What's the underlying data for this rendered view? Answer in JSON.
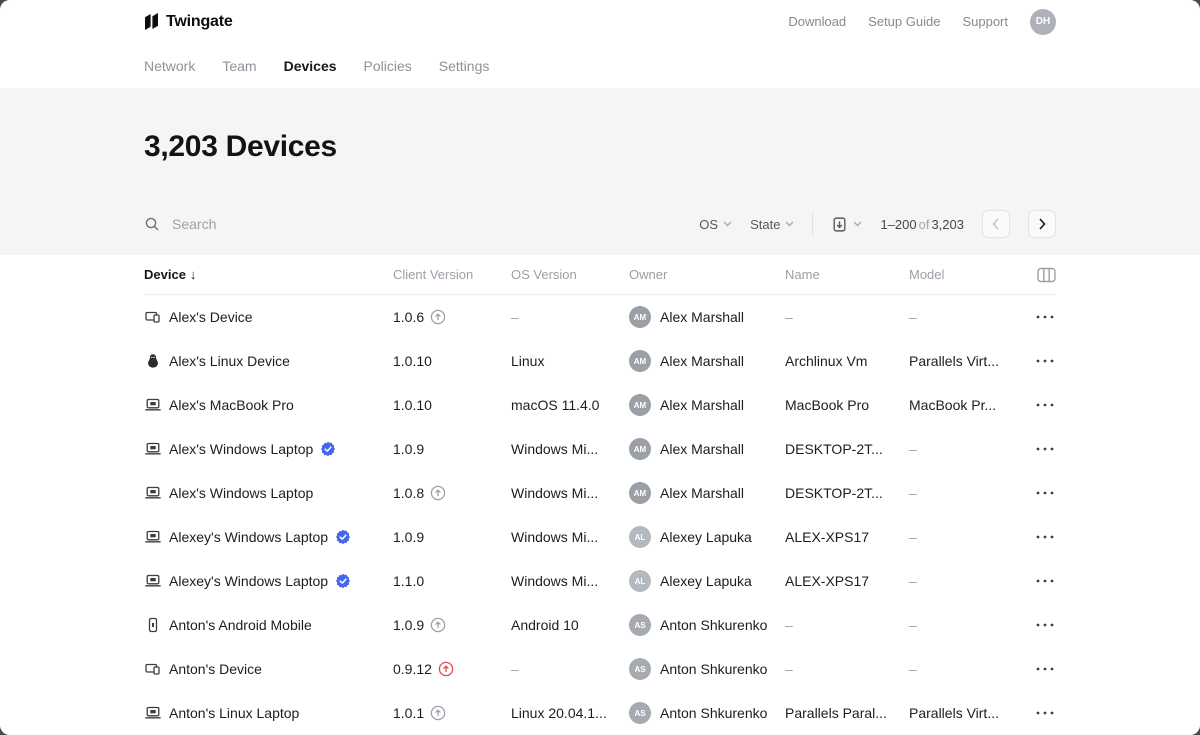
{
  "header": {
    "logo_text": "Twingate",
    "links": [
      {
        "label": "Download"
      },
      {
        "label": "Setup Guide"
      },
      {
        "label": "Support"
      }
    ],
    "avatar_initials": "DH"
  },
  "nav": {
    "items": [
      {
        "label": "Network",
        "active": false
      },
      {
        "label": "Team",
        "active": false
      },
      {
        "label": "Devices",
        "active": true
      },
      {
        "label": "Policies",
        "active": false
      },
      {
        "label": "Settings",
        "active": false
      }
    ]
  },
  "page": {
    "title": "3,203 Devices"
  },
  "toolbar": {
    "search_placeholder": "Search",
    "filters": [
      {
        "label": "OS"
      },
      {
        "label": "State"
      }
    ],
    "pagination": {
      "range": "1–200",
      "of_label": "of",
      "total": "3,203"
    }
  },
  "table": {
    "columns": {
      "device": "Device",
      "client_version": "Client Version",
      "os_version": "OS Version",
      "owner": "Owner",
      "name": "Name",
      "model": "Model"
    },
    "sort_arrow": "↓",
    "rows": [
      {
        "icon": "device-combo",
        "device": "Alex's Device",
        "verified": false,
        "client_version": "1.0.6",
        "update": "gray",
        "os_version": "–",
        "owner": {
          "initials": "AM",
          "name": "Alex Marshall",
          "color": "#9b9fa6"
        },
        "name": "–",
        "model": "–"
      },
      {
        "icon": "linux",
        "device": "Alex's Linux Device",
        "verified": false,
        "client_version": "1.0.10",
        "update": null,
        "os_version": "Linux",
        "owner": {
          "initials": "AM",
          "name": "Alex Marshall",
          "color": "#9b9fa6"
        },
        "name": "Archlinux Vm",
        "model": "Parallels Virt..."
      },
      {
        "icon": "laptop",
        "device": "Alex's MacBook Pro",
        "verified": false,
        "client_version": "1.0.10",
        "update": null,
        "os_version": "macOS 11.4.0",
        "owner": {
          "initials": "AM",
          "name": "Alex Marshall",
          "color": "#9b9fa6"
        },
        "name": "MacBook Pro",
        "model": "MacBook Pr..."
      },
      {
        "icon": "laptop",
        "device": "Alex's Windows Laptop",
        "verified": true,
        "client_version": "1.0.9",
        "update": null,
        "os_version": "Windows Mi...",
        "owner": {
          "initials": "AM",
          "name": "Alex Marshall",
          "color": "#9b9fa6"
        },
        "name": "DESKTOP-2T...",
        "model": "–"
      },
      {
        "icon": "laptop",
        "device": "Alex's Windows Laptop",
        "verified": false,
        "client_version": "1.0.8",
        "update": "gray",
        "os_version": "Windows Mi...",
        "owner": {
          "initials": "AM",
          "name": "Alex Marshall",
          "color": "#9b9fa6"
        },
        "name": "DESKTOP-2T...",
        "model": "–"
      },
      {
        "icon": "laptop",
        "device": "Alexey's Windows Laptop",
        "verified": true,
        "client_version": "1.0.9",
        "update": null,
        "os_version": "Windows Mi...",
        "owner": {
          "initials": "AL",
          "name": "Alexey Lapuka",
          "color": "#b4b9bf"
        },
        "name": "ALEX-XPS17",
        "model": "–"
      },
      {
        "icon": "laptop",
        "device": "Alexey's Windows Laptop",
        "verified": true,
        "client_version": "1.1.0",
        "update": null,
        "os_version": "Windows Mi...",
        "owner": {
          "initials": "AL",
          "name": "Alexey Lapuka",
          "color": "#b4b9bf"
        },
        "name": "ALEX-XPS17",
        "model": "–"
      },
      {
        "icon": "phone",
        "device": "Anton's Android Mobile",
        "verified": false,
        "client_version": "1.0.9",
        "update": "gray",
        "os_version": "Android 10",
        "owner": {
          "initials": "AS",
          "name": "Anton Shkurenko",
          "color": "#a6abb1"
        },
        "name": "–",
        "model": "–"
      },
      {
        "icon": "device-combo",
        "device": "Anton's Device",
        "verified": false,
        "client_version": "0.9.12",
        "update": "red",
        "os_version": "–",
        "owner": {
          "initials": "AS",
          "name": "Anton Shkurenko",
          "color": "#a6abb1"
        },
        "name": "–",
        "model": "–"
      },
      {
        "icon": "laptop",
        "device": "Anton's Linux Laptop",
        "verified": false,
        "client_version": "1.0.1",
        "update": "gray",
        "os_version": "Linux 20.04.1...",
        "owner": {
          "initials": "AS",
          "name": "Anton Shkurenko",
          "color": "#a6abb1"
        },
        "name": "Parallels Paral...",
        "model": "Parallels Virt..."
      }
    ]
  },
  "colors": {
    "verified_badge": "#4567f0",
    "update_gray": "#9ba0a7",
    "update_red": "#e5484d"
  }
}
